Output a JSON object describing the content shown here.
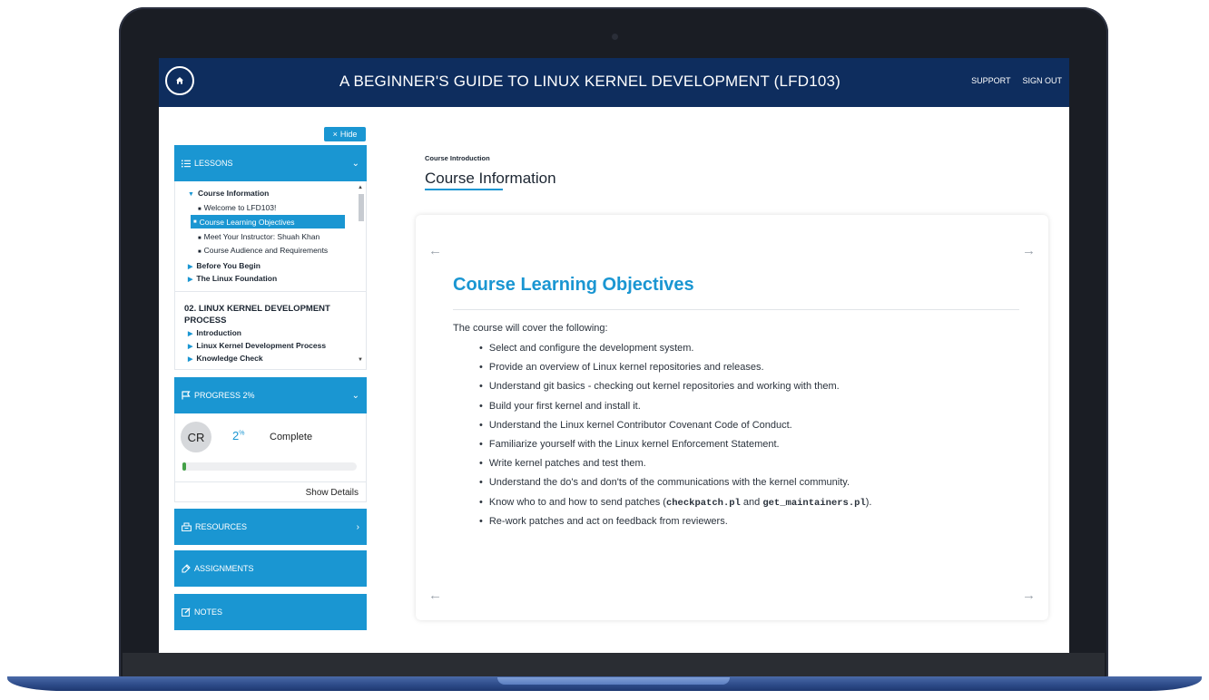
{
  "header": {
    "course_title": "A BEGINNER'S GUIDE TO LINUX KERNEL DEVELOPMENT (LFD103)",
    "support": "SUPPORT",
    "sign_out": "SIGN OUT"
  },
  "sidebar": {
    "hide_label": "Hide",
    "lessons": {
      "header": "LESSONS",
      "section_1": "Course Information",
      "items": [
        "Welcome to LFD103!",
        "Course Learning Objectives",
        "Meet Your Instructor: Shuah Khan",
        "Course Audience and Requirements"
      ],
      "sections_collapsed": [
        "Before You Begin",
        "The Linux Foundation"
      ],
      "module_2": {
        "title": "02. LINUX KERNEL DEVELOPMENT PROCESS",
        "sections": [
          "Introduction",
          "Linux Kernel Development Process",
          "Knowledge Check"
        ]
      }
    },
    "progress": {
      "header": "PROGRESS 2%",
      "avatar_initials": "CR",
      "percent": "2",
      "percent_sign": "%",
      "complete_label": "Complete",
      "show_details": "Show Details",
      "fraction": 0.02
    },
    "resources": "RESOURCES",
    "assignments": "ASSIGNMENTS",
    "notes": "NOTES"
  },
  "main": {
    "breadcrumb": "Course Introduction",
    "page_title": "Course Information",
    "card_title": "Course Learning Objectives",
    "intro": "The course will cover the following:",
    "objectives": [
      "Select and configure the development system.",
      "Provide an overview of Linux kernel repositories and releases.",
      "Understand git basics - checking out kernel repositories and working with them.",
      "Build your first kernel and install it.",
      "Understand the Linux kernel Contributor Covenant Code of Conduct.",
      "Familiarize yourself with the Linux kernel Enforcement Statement.",
      "Write kernel patches and test them.",
      "Understand the do's and don'ts of the communications with the kernel community."
    ],
    "objective_9": {
      "prefix": "Know who to and how to send patches (",
      "code_1": "checkpatch.pl",
      "middle": " and ",
      "code_2": "get_maintainers.pl",
      "suffix": ")."
    },
    "objective_10": "Re-work patches and act on feedback from reviewers."
  },
  "colors": {
    "navy": "#0e2d5e",
    "accent_blue": "#1a96d2",
    "progress_green": "#43a047"
  },
  "icons": [
    "home-icon",
    "close-icon",
    "list-icon",
    "chevron-down-icon",
    "flag-icon",
    "chevron-right-icon",
    "resources-icon",
    "assignments-icon",
    "notes-icon",
    "arrow-left-icon",
    "arrow-right-icon"
  ]
}
